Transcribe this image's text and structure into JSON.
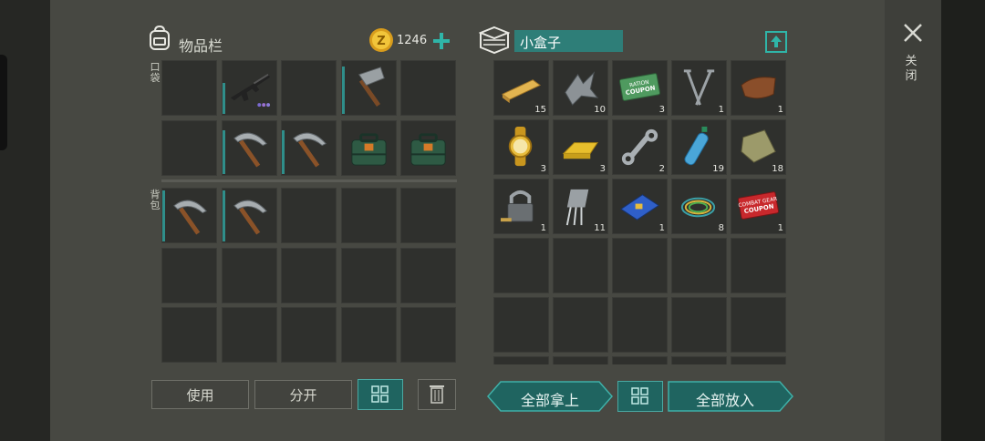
{
  "inventory": {
    "title": "物品栏",
    "coins": "1246",
    "pocket_label": "口袋",
    "backpack_label": "背包",
    "pocket_slots": [
      {
        "item": "",
        "count": ""
      },
      {
        "item": "assault-rifle",
        "count": ""
      },
      {
        "item": "",
        "count": ""
      },
      {
        "item": "hammer",
        "count": ""
      },
      {
        "item": "",
        "count": ""
      },
      {
        "item": "",
        "count": ""
      },
      {
        "item": "pickaxe",
        "count": ""
      },
      {
        "item": "pickaxe",
        "count": ""
      },
      {
        "item": "toolbox",
        "count": ""
      },
      {
        "item": "toolbox",
        "count": ""
      }
    ],
    "backpack_slots": [
      {
        "item": "pickaxe",
        "count": ""
      },
      {
        "item": "pickaxe",
        "count": ""
      },
      {
        "item": "",
        "count": ""
      },
      {
        "item": "",
        "count": ""
      },
      {
        "item": "",
        "count": ""
      },
      {
        "item": "",
        "count": ""
      },
      {
        "item": "",
        "count": ""
      },
      {
        "item": "",
        "count": ""
      },
      {
        "item": "",
        "count": ""
      },
      {
        "item": "",
        "count": ""
      },
      {
        "item": "",
        "count": ""
      },
      {
        "item": "",
        "count": ""
      },
      {
        "item": "",
        "count": ""
      },
      {
        "item": "",
        "count": ""
      },
      {
        "item": "",
        "count": ""
      }
    ],
    "buttons": {
      "use": "使用",
      "split": "分开"
    }
  },
  "container": {
    "title": "小盒子",
    "slots": [
      {
        "item": "wood-plank",
        "count": "15"
      },
      {
        "item": "scrap-metal",
        "count": "10"
      },
      {
        "item": "coupon",
        "count": "3",
        "text1": "RATION",
        "text2": "COUPON"
      },
      {
        "item": "nails",
        "count": "1"
      },
      {
        "item": "leather",
        "count": "1"
      },
      {
        "item": "gold-watch",
        "count": "3"
      },
      {
        "item": "gold-bar",
        "count": "3"
      },
      {
        "item": "wrench",
        "count": "2"
      },
      {
        "item": "water-bottle",
        "count": "19"
      },
      {
        "item": "cloth",
        "count": "18"
      },
      {
        "item": "padlock",
        "count": "1"
      },
      {
        "item": "transistor",
        "count": "11"
      },
      {
        "item": "circuit-board",
        "count": "1"
      },
      {
        "item": "wires",
        "count": "8"
      },
      {
        "item": "combat-coupon",
        "count": "1",
        "text1": "COMBAT GEAR",
        "text2": "COUPON"
      },
      {
        "item": "",
        "count": ""
      },
      {
        "item": "",
        "count": ""
      },
      {
        "item": "",
        "count": ""
      },
      {
        "item": "",
        "count": ""
      },
      {
        "item": "",
        "count": ""
      },
      {
        "item": "",
        "count": ""
      },
      {
        "item": "",
        "count": ""
      },
      {
        "item": "",
        "count": ""
      },
      {
        "item": "",
        "count": ""
      },
      {
        "item": "",
        "count": ""
      },
      {
        "item": "",
        "count": ""
      },
      {
        "item": "",
        "count": ""
      },
      {
        "item": "",
        "count": ""
      },
      {
        "item": "",
        "count": ""
      },
      {
        "item": "",
        "count": ""
      }
    ],
    "buttons": {
      "take_all": "全部拿上",
      "put_all": "全部放入"
    }
  },
  "close_label": "关闭",
  "colors": {
    "accent": "#1f6460",
    "panel": "#474842",
    "cell": "#2f302d",
    "bar": "#2f8e8a"
  }
}
